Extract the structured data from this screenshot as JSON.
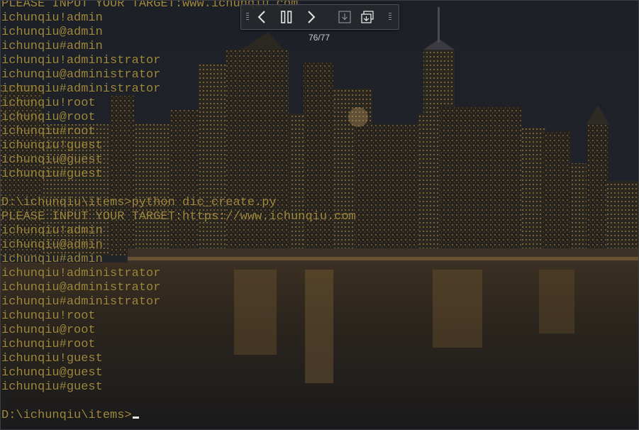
{
  "terminal": {
    "lines": [
      "PLEASE INPUT YOUR TARGET:www.ichunqiu.com",
      "ichunqiu!admin",
      "ichunqiu@admin",
      "ichunqiu#admin",
      "ichunqiu!administrator",
      "ichunqiu@administrator",
      "ichunqiu#administrator",
      "ichunqiu!root",
      "ichunqiu@root",
      "ichunqiu#root",
      "ichunqiu!guest",
      "ichunqiu@guest",
      "ichunqiu#guest",
      "",
      "D:\\ichunqiu\\items>python dic_create.py",
      "PLEASE INPUT YOUR TARGET:https://www.ichunqiu.com",
      "ichunqiu!admin",
      "ichunqiu@admin",
      "ichunqiu#admin",
      "ichunqiu!administrator",
      "ichunqiu@administrator",
      "ichunqiu#administrator",
      "ichunqiu!root",
      "ichunqiu@root",
      "ichunqiu#root",
      "ichunqiu!guest",
      "ichunqiu@guest",
      "ichunqiu#guest",
      "",
      "D:\\ichunqiu\\items>"
    ]
  },
  "viewer": {
    "counter": "76/77",
    "icons": {
      "prev": "chevron-left-icon",
      "pause": "pause-icon",
      "next": "chevron-right-icon",
      "save": "download-icon",
      "gallery": "multi-window-icon"
    }
  },
  "colors": {
    "terminal_text": "#a08a3f",
    "toolbar_bg": "#26282e",
    "icon": "#e6e6e6"
  }
}
